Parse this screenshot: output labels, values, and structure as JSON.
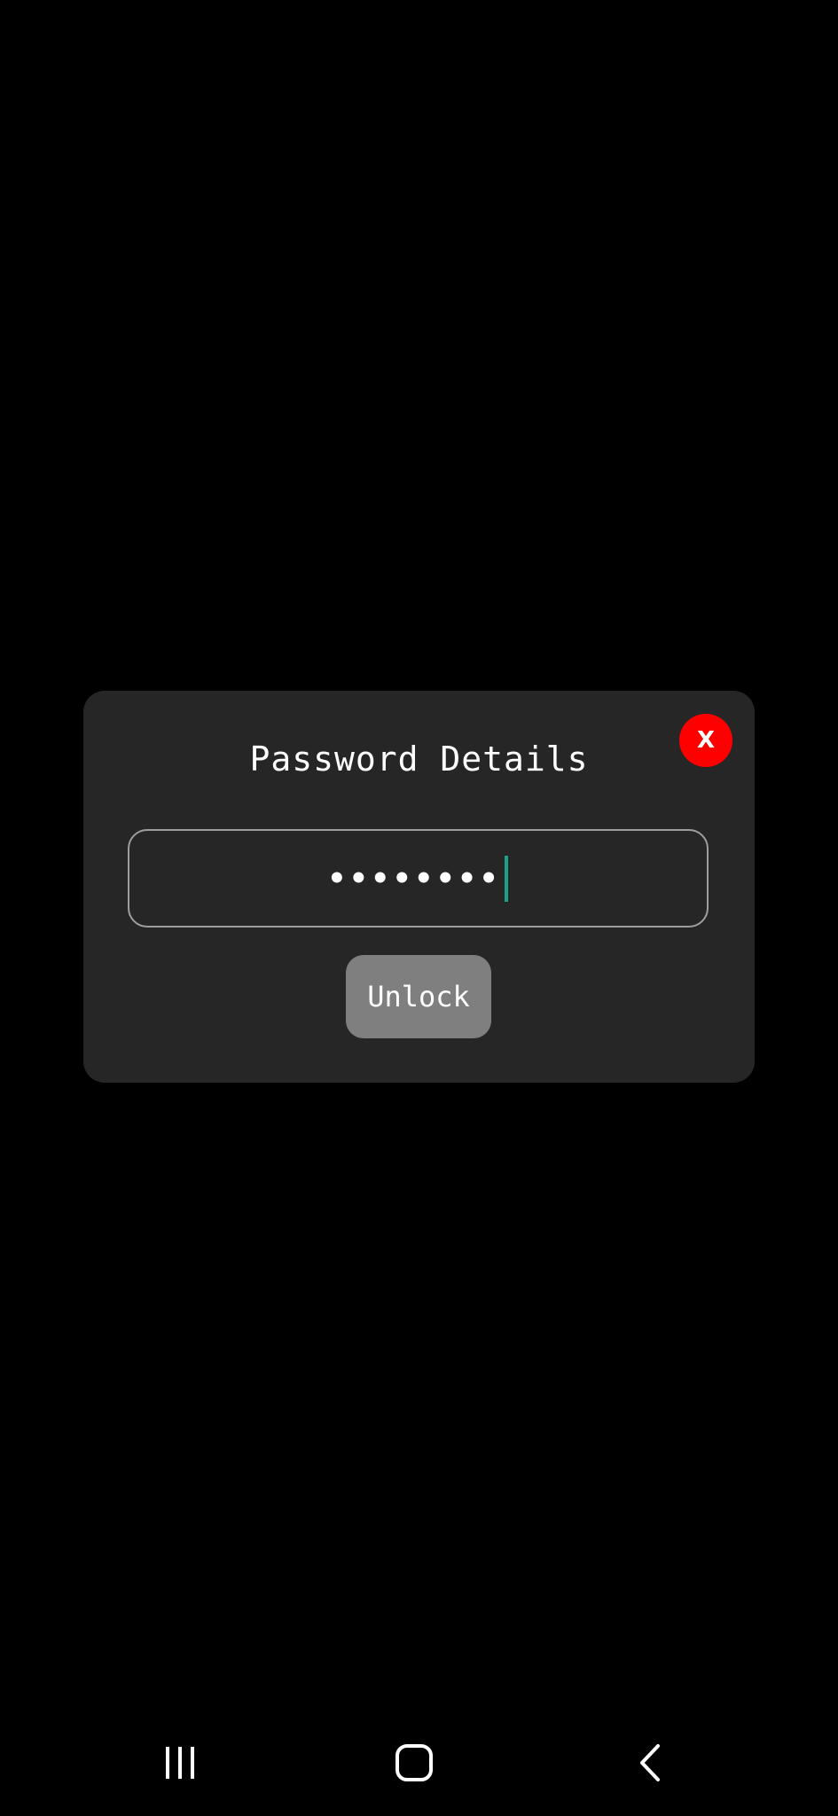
{
  "dialog": {
    "title": "Password Details",
    "close_label": "X",
    "password_value": "••••••••",
    "unlock_label": "Unlock"
  },
  "colors": {
    "background": "#000000",
    "dialog_bg": "#262626",
    "close_button": "#ff0000",
    "unlock_button": "#7f7f7f",
    "caret": "#1fa08a"
  },
  "navigation_bar": {
    "icons": [
      "recent-apps-icon",
      "home-icon",
      "back-icon"
    ]
  }
}
